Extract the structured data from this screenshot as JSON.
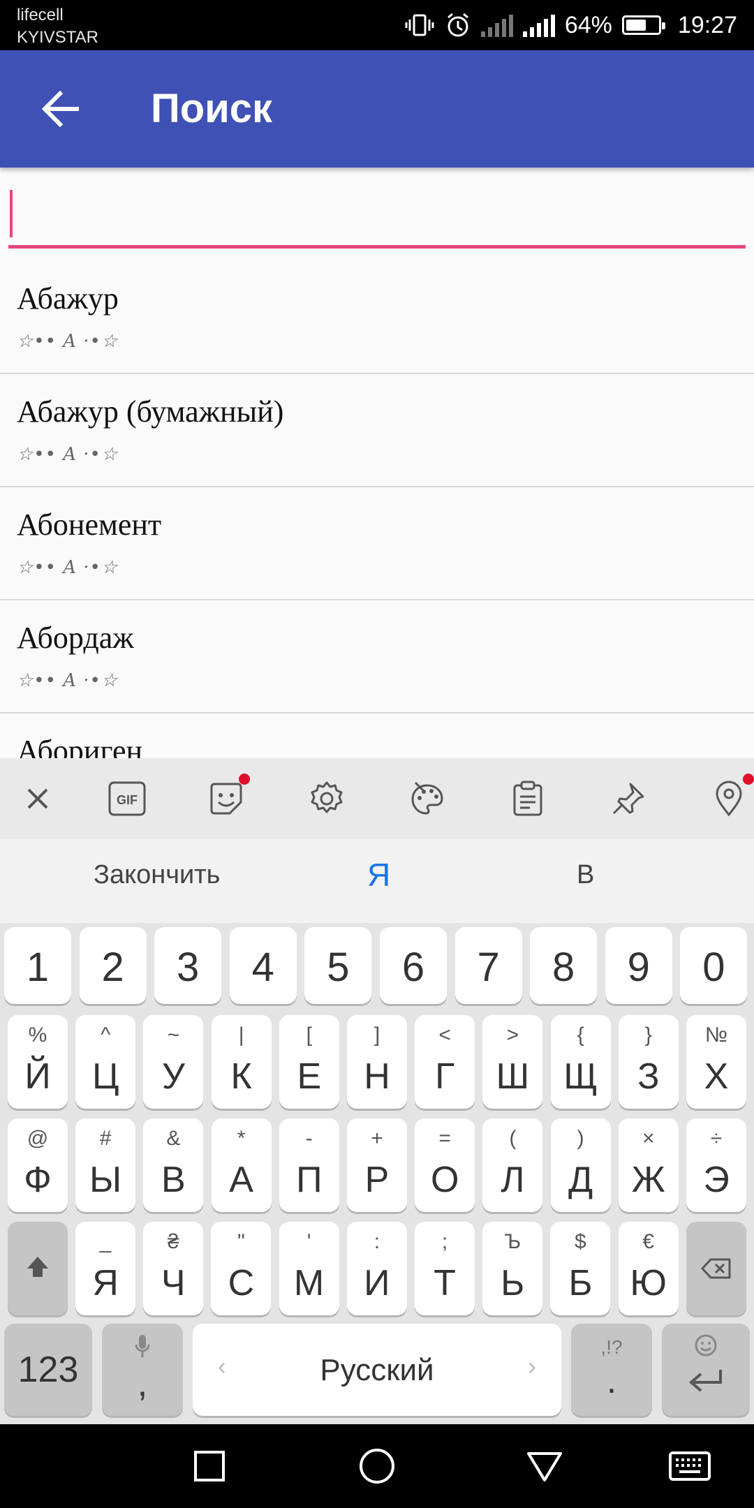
{
  "status": {
    "carrier1": "lifecell",
    "carrier2": "KYIVSTAR",
    "battery": "64%",
    "time": "19:27",
    "battery_level": 0.64
  },
  "appbar": {
    "title": "Поиск",
    "back_icon": "arrow-left-icon"
  },
  "search": {
    "value": "",
    "placeholder": ""
  },
  "list": [
    {
      "title": "Абажур",
      "sub": "☆•• A ·•☆"
    },
    {
      "title": "Абажур (бумажный)",
      "sub": "☆•• A ·•☆"
    },
    {
      "title": "Абонемент",
      "sub": "☆•• A ·•☆"
    },
    {
      "title": "Абордаж",
      "sub": "☆•• A ·•☆"
    },
    {
      "title": "Абориген",
      "sub": ""
    }
  ],
  "keyboard": {
    "toolbar": [
      "close-icon",
      "gif-icon",
      "sticker-icon",
      "gear-icon",
      "palette-icon",
      "clipboard-icon",
      "pin-icon",
      "location-icon"
    ],
    "toolbar_gif_label": "GIF",
    "suggestions": {
      "left": "Закончить",
      "center": "Я",
      "right": "В"
    },
    "row_numbers": [
      "1",
      "2",
      "3",
      "4",
      "5",
      "6",
      "7",
      "8",
      "9",
      "0"
    ],
    "row1": [
      {
        "k": "Й",
        "h": "%"
      },
      {
        "k": "Ц",
        "h": "^"
      },
      {
        "k": "У",
        "h": "~"
      },
      {
        "k": "К",
        "h": "|"
      },
      {
        "k": "Е",
        "h": "["
      },
      {
        "k": "Н",
        "h": "]"
      },
      {
        "k": "Г",
        "h": "<"
      },
      {
        "k": "Ш",
        "h": ">"
      },
      {
        "k": "Щ",
        "h": "{"
      },
      {
        "k": "З",
        "h": "}"
      },
      {
        "k": "Х",
        "h": "№"
      }
    ],
    "row2": [
      {
        "k": "Ф",
        "h": "@"
      },
      {
        "k": "Ы",
        "h": "#"
      },
      {
        "k": "В",
        "h": "&"
      },
      {
        "k": "А",
        "h": "*"
      },
      {
        "k": "П",
        "h": "-"
      },
      {
        "k": "Р",
        "h": "+"
      },
      {
        "k": "О",
        "h": "="
      },
      {
        "k": "Л",
        "h": "("
      },
      {
        "k": "Д",
        "h": ")"
      },
      {
        "k": "Ж",
        "h": "×"
      },
      {
        "k": "Э",
        "h": "÷"
      }
    ],
    "row3": [
      {
        "k": "Я",
        "h": "_"
      },
      {
        "k": "Ч",
        "h": "₴"
      },
      {
        "k": "С",
        "h": "\""
      },
      {
        "k": "М",
        "h": "'"
      },
      {
        "k": "И",
        "h": ":"
      },
      {
        "k": "Т",
        "h": ";"
      },
      {
        "k": "Ь",
        "h": "Ъ"
      },
      {
        "k": "Б",
        "h": "$"
      },
      {
        "k": "Ю",
        "h": "€"
      }
    ],
    "bottom": {
      "numbers_label": "123",
      "comma": ",",
      "space_label": "Русский",
      "period": ".",
      "period_hint": ",!?"
    }
  },
  "nav": [
    "recents-square-icon",
    "home-circle-icon",
    "back-triangle-icon",
    "keyboard-icon"
  ]
}
